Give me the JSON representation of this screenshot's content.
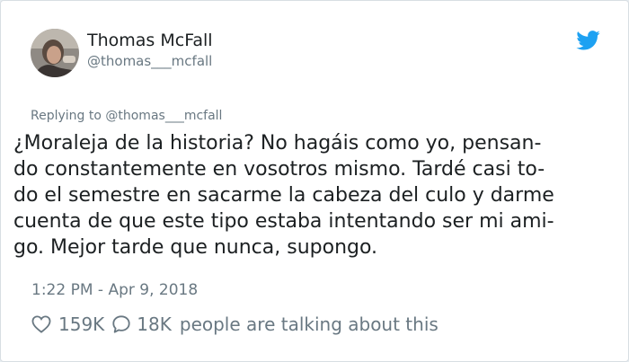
{
  "author": {
    "name": "Thomas McFall",
    "handle": "@thomas___mcfall"
  },
  "reply_context": "Replying to @thomas___mcfall",
  "tweet": {
    "lines": [
      "¿Moraleja de la historia? No hagáis como yo, pensan-",
      "do constantemente en vosotros mismo. Tardé casi to-",
      "do el semestre en sacarme la cabeza del culo y darme",
      "cuenta de que este tipo estaba intentando ser mi ami-",
      "go. Mejor tarde que nunca, supongo."
    ]
  },
  "timestamp": "1:22 PM - Apr 9, 2018",
  "engagement": {
    "likes": "159K",
    "replies": "18K",
    "talking_text": "people are talking about this"
  },
  "icons": {
    "brand": "twitter-bird-icon",
    "like": "heart-icon",
    "reply": "speech-bubble-icon"
  },
  "colors": {
    "brand": "#1da1f2",
    "text": "#1c2022",
    "muted": "#697882"
  }
}
